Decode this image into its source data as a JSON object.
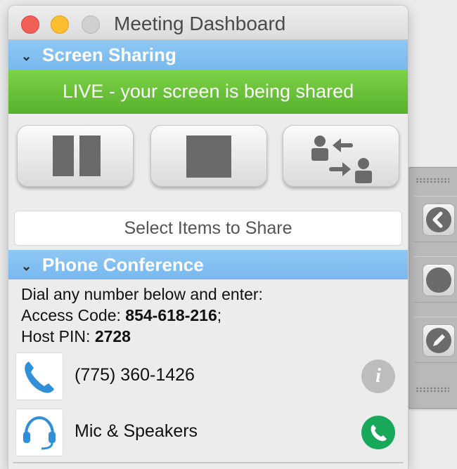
{
  "window": {
    "title": "Meeting Dashboard"
  },
  "screen_sharing": {
    "header": "Screen Sharing",
    "status": "LIVE - your screen is being shared",
    "buttons": [
      {
        "name": "pause",
        "icon": "pause-icon"
      },
      {
        "name": "stop",
        "icon": "stop-icon"
      },
      {
        "name": "change-presenter",
        "icon": "swap-presenter-icon"
      }
    ],
    "select_items_label": "Select Items to Share"
  },
  "phone_conference": {
    "header": "Phone Conference",
    "instructions": "Dial any number below and enter:",
    "access_code_label": "Access Code:",
    "access_code": "854-618-216",
    "access_code_suffix": ";",
    "host_pin_label": "Host PIN:",
    "host_pin": "2728",
    "phone_number": "(775) 360-1426",
    "audio_option": "Mic & Speakers"
  },
  "colors": {
    "header_blue": "#7fbef0",
    "live_green": "#5fb832",
    "call_green": "#17a85a",
    "phone_icon_blue": "#2f8fd8"
  },
  "side_toolbar": {
    "items": [
      {
        "icon": "chevron-left-icon"
      },
      {
        "icon": "record-circle-icon"
      },
      {
        "icon": "pencil-icon"
      }
    ]
  }
}
